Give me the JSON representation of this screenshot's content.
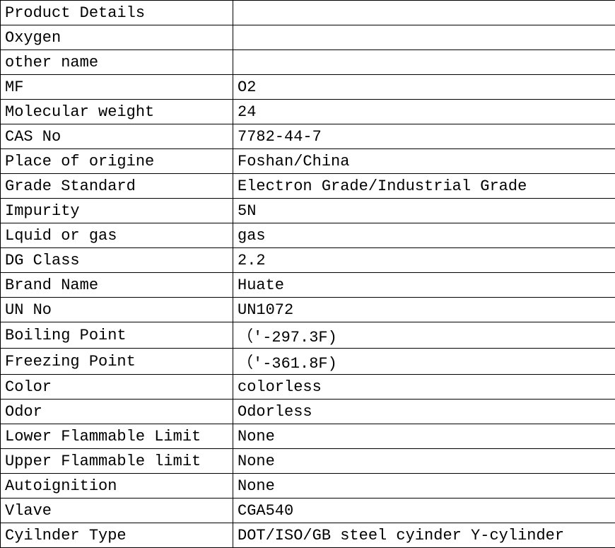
{
  "rows": [
    {
      "label": "Product Details",
      "value": ""
    },
    {
      "label": "Oxygen",
      "value": ""
    },
    {
      "label": "other name",
      "value": ""
    },
    {
      "label": "MF",
      "value": "O2"
    },
    {
      "label": "Molecular weight",
      "value": "24"
    },
    {
      "label": "CAS No",
      "value": "7782-44-7"
    },
    {
      "label": "Place of origine",
      "value": "Foshan/China"
    },
    {
      "label": "Grade Standard",
      "value": "Electron Grade/Industrial Grade"
    },
    {
      "label": "Impurity",
      "value": "5N"
    },
    {
      "label": "Lquid or gas",
      "value": "gas"
    },
    {
      "label": "DG Class",
      "value": "2.2"
    },
    {
      "label": "Brand Name",
      "value": "Huate"
    },
    {
      "label": "UN No",
      "value": "UN1072"
    },
    {
      "label": "Boiling Point",
      "value": "（'-297.3F)"
    },
    {
      "label": "Freezing Point",
      "value": "（'-361.8F)"
    },
    {
      "label": "Color",
      "value": " colorless"
    },
    {
      "label": "Odor",
      "value": "Odorless"
    },
    {
      "label": "Lower Flammable Limit",
      "value": "None"
    },
    {
      "label": "Upper Flammable limit",
      "value": "None"
    },
    {
      "label": "Autoignition",
      "value": "None"
    },
    {
      "label": "Vlave",
      "value": "CGA540"
    },
    {
      "label": "Cyilnder Type",
      "value": "DOT/ISO/GB steel cyinder  Y-cylinder"
    }
  ]
}
